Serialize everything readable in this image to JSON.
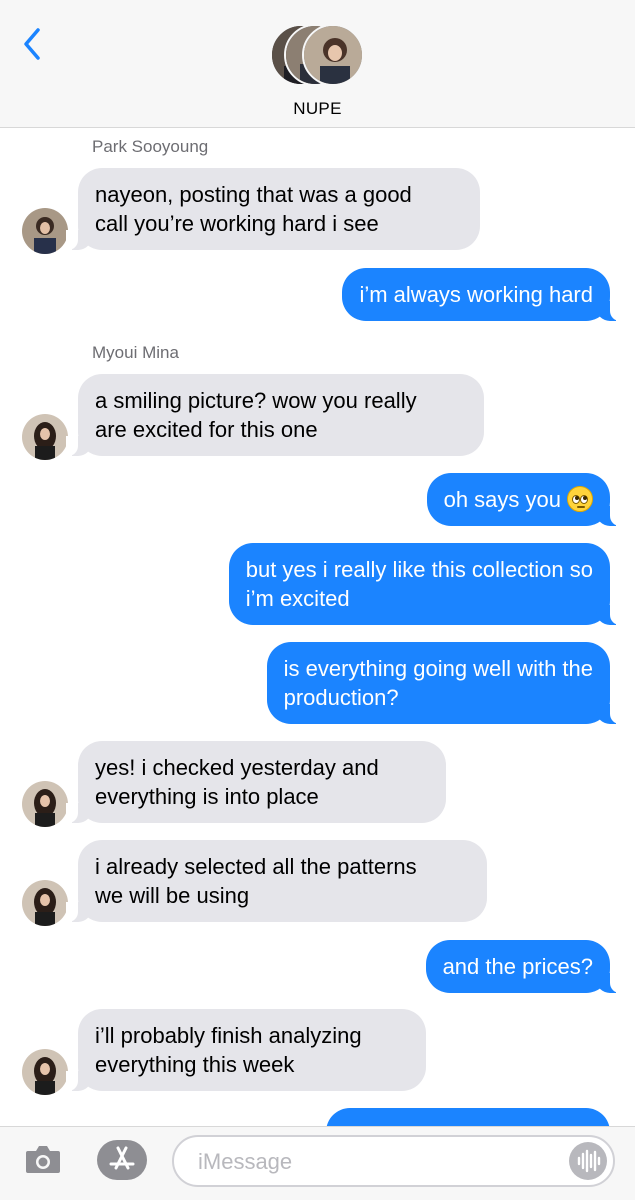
{
  "header": {
    "group_name": "NUPE",
    "icons": {
      "back": "chevron-left-icon",
      "group_avatars": "group-avatar-stack"
    }
  },
  "conversation": {
    "sender_1": "Park Sooyoung",
    "msg_1": "nayeon, posting that was a good\ncall you’re working hard i see",
    "msg_2": "i’m always working hard",
    "sender_2": "Myoui Mina",
    "msg_3": "a smiling picture? wow you really\nare excited for this one",
    "msg_4": "oh says you",
    "msg_4_emoji": "face-with-rolling-eyes-emoji",
    "msg_5": "but yes i really like this collection so\ni’m excited",
    "msg_6": "is everything going well with the\nproduction?",
    "msg_7": "yes! i checked yesterday  and\neverything is into place",
    "msg_8": "i already selected all the patterns\nwe will be using",
    "msg_9": "and the prices?",
    "msg_10": "i’ll probably finish analyzing\neverything this week"
  },
  "toolbar": {
    "input_placeholder": "iMessage",
    "input_value": "",
    "icons": {
      "camera": "camera-icon",
      "apps": "app-store-icon",
      "audio": "audio-waveform-icon"
    }
  },
  "colors": {
    "outgoing_bubble": "#1b84ff",
    "incoming_bubble": "#e5e5ea",
    "accent": "#1b84ff"
  }
}
